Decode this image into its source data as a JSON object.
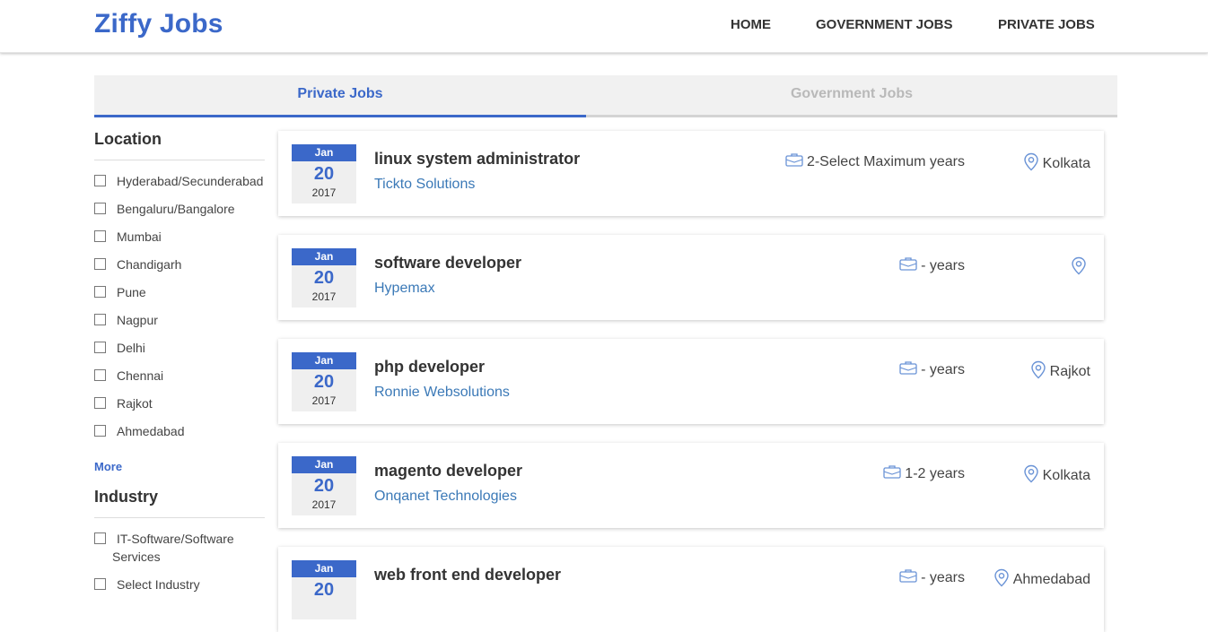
{
  "header": {
    "brand": "Ziffy Jobs",
    "nav": [
      "HOME",
      "GOVERNMENT JOBS",
      "PRIVATE JOBS"
    ]
  },
  "tabs": {
    "active": "Private Jobs",
    "inactive": "Government Jobs"
  },
  "sidebar": {
    "location": {
      "title": "Location",
      "items": [
        "Hyderabad/Secunderabad",
        "Bengaluru/Bangalore",
        "Mumbai",
        "Chandigarh",
        "Pune",
        "Nagpur",
        "Delhi",
        "Chennai",
        "Rajkot",
        "Ahmedabad"
      ],
      "more": "More"
    },
    "industry": {
      "title": "Industry",
      "items": [
        "IT-Software/Software",
        "Services",
        "Select Industry"
      ]
    }
  },
  "jobs": [
    {
      "month": "Jan",
      "day": "20",
      "year": "2017",
      "title": "linux system administrator",
      "company": "Tickto Solutions",
      "experience": "2-Select Maximum years",
      "location": "Kolkata"
    },
    {
      "month": "Jan",
      "day": "20",
      "year": "2017",
      "title": "software developer",
      "company": "Hypemax",
      "experience": "- years",
      "location": ""
    },
    {
      "month": "Jan",
      "day": "20",
      "year": "2017",
      "title": "php developer",
      "company": "Ronnie Websolutions",
      "experience": "- years",
      "location": "Rajkot"
    },
    {
      "month": "Jan",
      "day": "20",
      "year": "2017",
      "title": "magento developer",
      "company": "Onqanet Technologies",
      "experience": "1-2 years",
      "location": "Kolkata"
    },
    {
      "month": "Jan",
      "day": "20",
      "year": "",
      "title": "web front end developer",
      "company": "",
      "experience": "- years",
      "location": "Ahmedabad"
    }
  ],
  "colors": {
    "brand": "#3b68c9",
    "company_link": "#3b79b7"
  },
  "icons": {
    "experience": "briefcase-icon",
    "location": "map-pin-icon"
  }
}
